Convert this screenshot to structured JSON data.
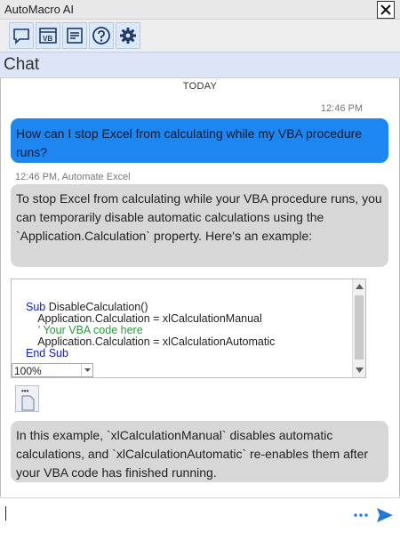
{
  "window": {
    "title": "AutoMacro AI"
  },
  "toolbar": {
    "items": [
      "chat-icon",
      "vb-editor-icon",
      "snippets-icon",
      "help-icon",
      "settings-icon"
    ],
    "vb_label": "VB"
  },
  "header": {
    "title": "Chat"
  },
  "chat": {
    "date_divider": "TODAY",
    "user_time": "12:46 PM",
    "user_message": "How can I stop Excel from calculating while my VBA procedure runs?",
    "bot_meta": "12:46 PM, Automate Excel",
    "bot_message_1": "To stop Excel from calculating while your VBA procedure runs, you can temporarily disable automatic calculations using the `Application.Calculation` property. Here's an example:",
    "code_lines": [
      {
        "prefix": "Sub ",
        "text": "DisableCalculation()"
      },
      {
        "prefix": "",
        "text": "    Application.Calculation = xlCalculationManual"
      },
      {
        "prefix": "",
        "text": "    ' Your VBA code here",
        "comment": true
      },
      {
        "prefix": "",
        "text": "    Application.Calculation = xlCalculationAutomatic"
      },
      {
        "prefix": "End Sub",
        "text": ""
      }
    ],
    "zoom": "100%",
    "copy_dots": "•••",
    "bot_message_2": "In this example, `xlCalculationManual` disables automatic calculations, and `xlCalculationAutomatic` re-enables them after your VBA code has finished running."
  },
  "input": {
    "value": "",
    "more_label": "•••"
  },
  "colors": {
    "user_bubble": "#1e86f0",
    "bot_bubble": "#d7d7d7",
    "header_bg": "#dde4f5",
    "send": "#1e78d8"
  }
}
